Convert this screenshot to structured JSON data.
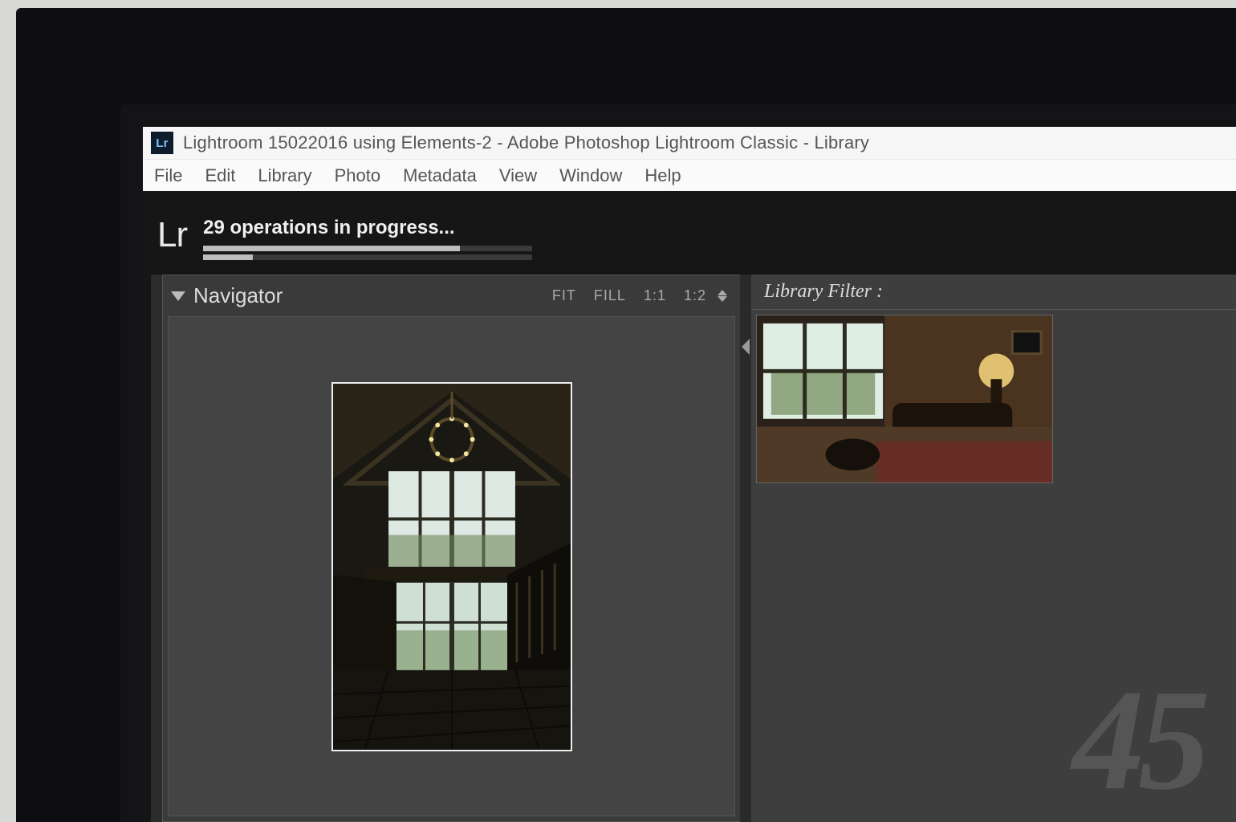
{
  "titlebar": {
    "app_badge": "Lr",
    "title": "Lightroom 15022016 using Elements-2 - Adobe Photoshop Lightroom Classic - Library"
  },
  "menubar": [
    "File",
    "Edit",
    "Library",
    "Photo",
    "Metadata",
    "View",
    "Window",
    "Help"
  ],
  "identity": {
    "mark": "Lr",
    "progress_label": "29 operations in progress..."
  },
  "navigator": {
    "title": "Navigator",
    "zoom": {
      "fit": "FIT",
      "fill": "FILL",
      "one": "1:1",
      "ratio": "1:2"
    }
  },
  "library_filter": {
    "title": "Library Filter :"
  },
  "grid": {
    "cell_number": "45"
  }
}
